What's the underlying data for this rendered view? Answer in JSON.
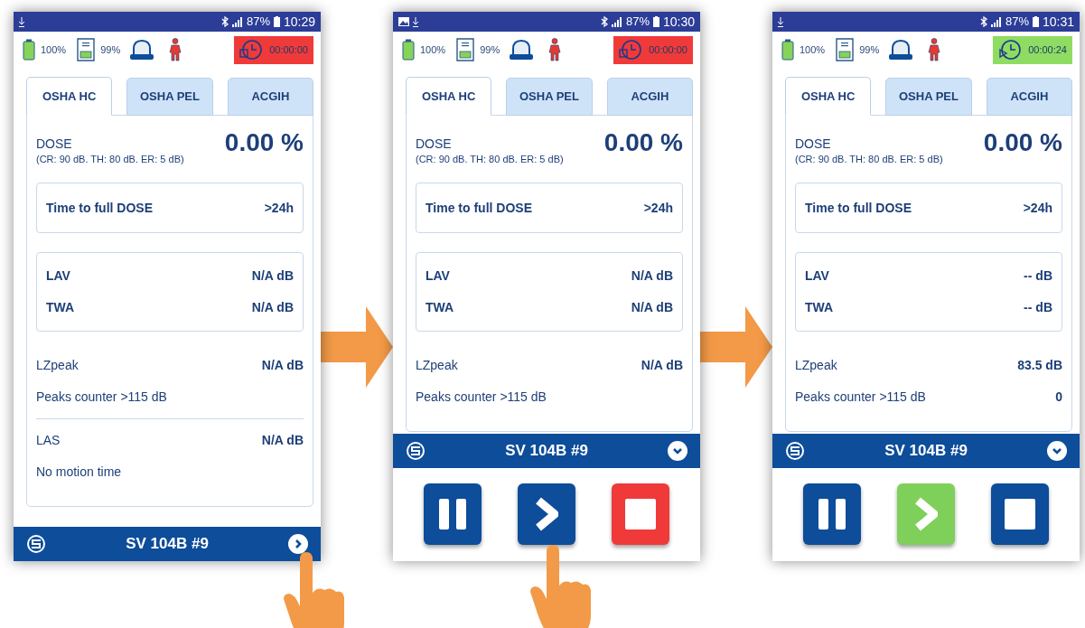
{
  "phones": [
    {
      "status_bar": {
        "image_notification": false,
        "battery": "87%",
        "time": "10:29"
      },
      "indicators": {
        "battery": "100%",
        "storage": "99%"
      },
      "timer": {
        "running": false,
        "time": "00:00:00"
      },
      "tabs": [
        {
          "label": "OSHA HC",
          "selected": true
        },
        {
          "label": "OSHA PEL",
          "selected": false
        },
        {
          "label": "ACGIH",
          "selected": false
        }
      ],
      "dose": {
        "label": "DOSE",
        "params": "(CR: 90 dB. TH: 80 dB. ER: 5 dB)",
        "value": "0.00 %"
      },
      "time_to_full": {
        "label": "Time to full DOSE",
        "value": ">24h"
      },
      "levels": [
        {
          "label": "LAV",
          "value": "N/A dB"
        },
        {
          "label": "TWA",
          "value": "N/A dB"
        }
      ],
      "sections": [
        [
          {
            "label": "LZpeak",
            "value": "N/A dB"
          },
          {
            "label": "Peaks counter >115 dB"
          }
        ],
        [
          {
            "label": "LAS",
            "value": "N/A dB"
          },
          {
            "label": "No motion time"
          }
        ]
      ],
      "footer": {
        "title": "SV 104B #9",
        "expanded": false,
        "pointer": true
      }
    },
    {
      "status_bar": {
        "image_notification": true,
        "battery": "87%",
        "time": "10:30"
      },
      "indicators": {
        "battery": "100%",
        "storage": "99%"
      },
      "timer": {
        "running": false,
        "time": "00:00:00"
      },
      "tabs": [
        {
          "label": "OSHA HC",
          "selected": true
        },
        {
          "label": "OSHA PEL",
          "selected": false
        },
        {
          "label": "ACGIH",
          "selected": false
        }
      ],
      "dose": {
        "label": "DOSE",
        "params": "(CR: 90 dB. TH: 80 dB. ER: 5 dB)",
        "value": "0.00 %"
      },
      "time_to_full": {
        "label": "Time to full DOSE",
        "value": ">24h"
      },
      "levels": [
        {
          "label": "LAV",
          "value": "N/A dB"
        },
        {
          "label": "TWA",
          "value": "N/A dB"
        }
      ],
      "sections": [
        [
          {
            "label": "LZpeak",
            "value": "N/A dB"
          },
          {
            "label": "Peaks counter >115 dB"
          }
        ]
      ],
      "footer": {
        "title": "SV 104B #9",
        "expanded": true
      },
      "controls": [
        {
          "kind": "pause",
          "active": false
        },
        {
          "kind": "play",
          "active": false,
          "pointer": true
        },
        {
          "kind": "stop",
          "active": true
        }
      ]
    },
    {
      "status_bar": {
        "image_notification": false,
        "battery": "87%",
        "time": "10:31"
      },
      "indicators": {
        "battery": "100%",
        "storage": "99%"
      },
      "timer": {
        "running": true,
        "time": "00:00:24"
      },
      "tabs": [
        {
          "label": "OSHA HC",
          "selected": true
        },
        {
          "label": "OSHA PEL",
          "selected": false
        },
        {
          "label": "ACGIH",
          "selected": false
        }
      ],
      "dose": {
        "label": "DOSE",
        "params": "(CR: 90 dB. TH: 80 dB. ER: 5 dB)",
        "value": "0.00 %"
      },
      "time_to_full": {
        "label": "Time to full DOSE",
        "value": ">24h"
      },
      "levels": [
        {
          "label": "LAV",
          "value": "-- dB"
        },
        {
          "label": "TWA",
          "value": "-- dB"
        }
      ],
      "sections": [
        [
          {
            "label": "LZpeak",
            "value": "83.5 dB"
          },
          {
            "label": "Peaks counter >115 dB",
            "value": "0"
          }
        ]
      ],
      "footer": {
        "title": "SV 104B #9",
        "expanded": true
      },
      "controls": [
        {
          "kind": "pause",
          "active": false
        },
        {
          "kind": "play",
          "active": true
        },
        {
          "kind": "stop",
          "active": false
        }
      ]
    }
  ]
}
